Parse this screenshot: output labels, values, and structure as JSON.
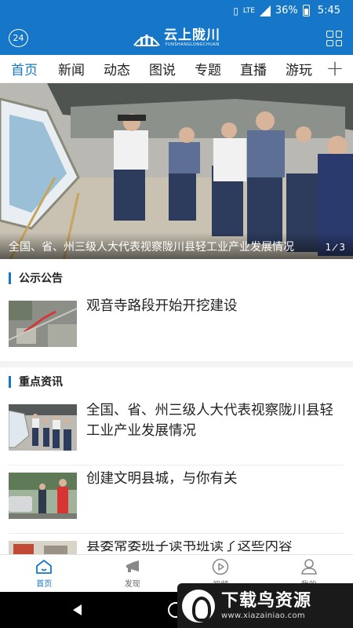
{
  "status_bar": {
    "network": "LTE",
    "battery_percent": "36%",
    "time": "5:45"
  },
  "header": {
    "date_badge": "24",
    "logo_cn": "云上陇川",
    "logo_en": "YUNSHANGLONGCHUAN"
  },
  "tabs": [
    {
      "label": "首页",
      "active": true
    },
    {
      "label": "新闻",
      "active": false
    },
    {
      "label": "动态",
      "active": false
    },
    {
      "label": "图说",
      "active": false
    },
    {
      "label": "专题",
      "active": false
    },
    {
      "label": "直播",
      "active": false
    },
    {
      "label": "游玩",
      "active": false
    }
  ],
  "tabs_more": "+",
  "banner": {
    "caption": "全国、省、州三级人大代表视察陇川县轻工业产业发展情况",
    "index_current": "1",
    "index_total": "3"
  },
  "sections": {
    "notice": {
      "title": "公示公告",
      "items": [
        {
          "title": "观音寺路段开始开挖建设"
        }
      ]
    },
    "key_news": {
      "title": "重点资讯",
      "items": [
        {
          "title": "全国、省、州三级人大代表视察陇川县轻工业产业发展情况"
        },
        {
          "title": "创建文明县城，与你有关"
        },
        {
          "title": "县委常委班子读书班读了这些内容"
        }
      ]
    }
  },
  "bottom_nav": [
    {
      "label": "首页",
      "icon": "home-icon",
      "active": true
    },
    {
      "label": "发现",
      "icon": "megaphone-icon",
      "active": false
    },
    {
      "label": "视频",
      "icon": "play-icon",
      "active": false
    },
    {
      "label": "我的",
      "icon": "user-icon",
      "active": false
    }
  ],
  "watermark": {
    "brand": "下载鸟资源",
    "url": "www.xiazainiao.com"
  },
  "colors": {
    "brand_blue": "#1677c9",
    "text": "#222222",
    "divider": "#f3f3f3"
  }
}
